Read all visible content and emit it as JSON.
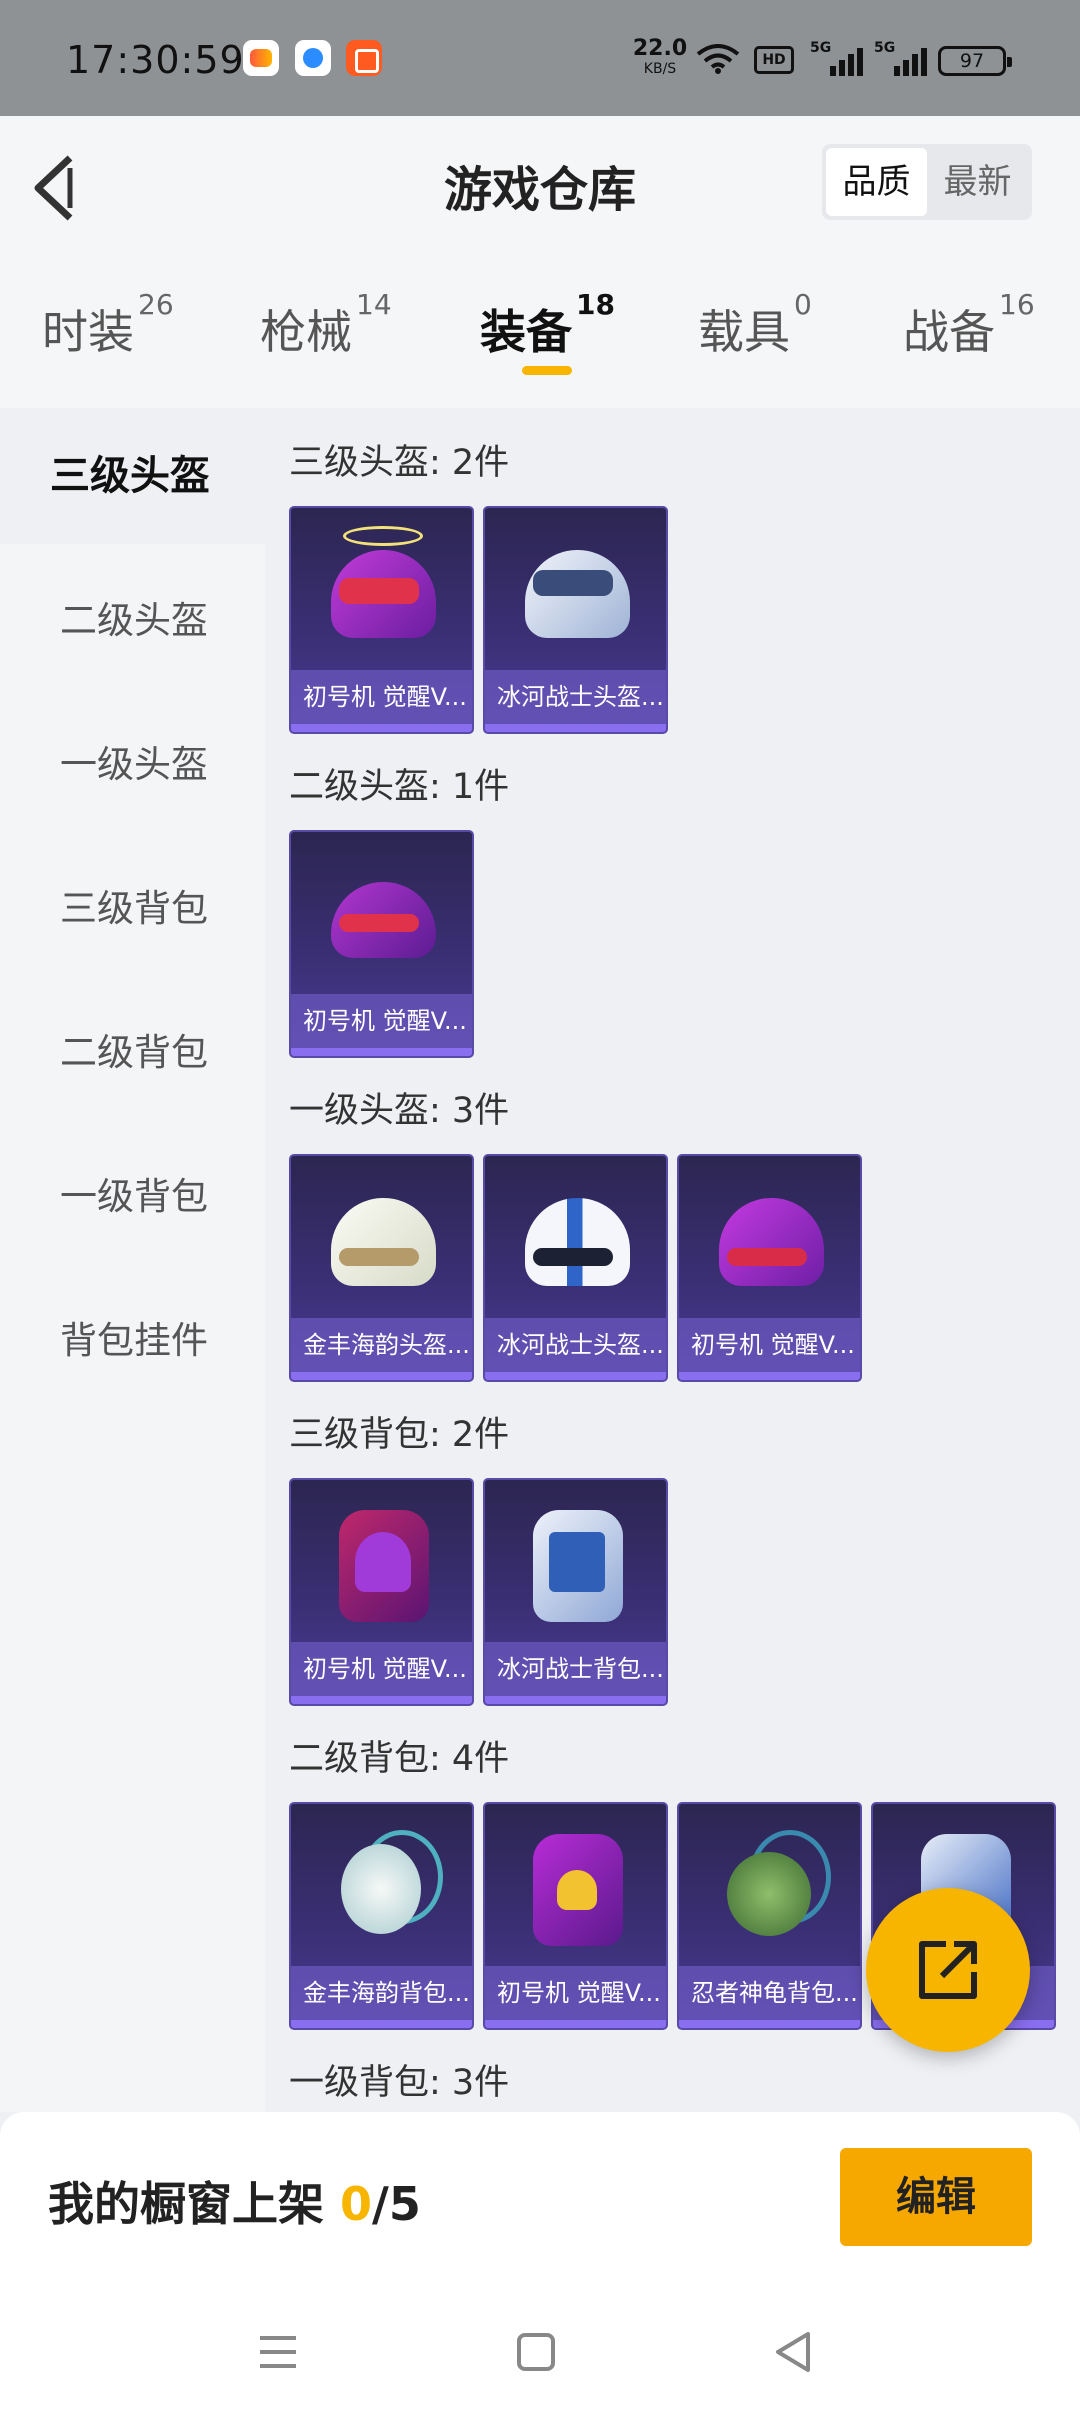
{
  "status_bar": {
    "time": "17:30:59",
    "net_speed": "22.0",
    "net_unit": "KB/S",
    "hd_badge": "HD",
    "signal_1": "5G",
    "signal_2": "5G",
    "battery": "97",
    "icons": [
      "game-app-icon",
      "search-app-icon",
      "camera-app-icon",
      "wifi-icon",
      "hd-icon",
      "signal-icon",
      "signal-icon",
      "battery-icon"
    ]
  },
  "header": {
    "title": "游戏仓库",
    "sort": {
      "quality": "品质",
      "latest": "最新",
      "active": "quality"
    }
  },
  "tabs": [
    {
      "name": "时装",
      "count": "26"
    },
    {
      "name": "枪械",
      "count": "14"
    },
    {
      "name": "装备",
      "count": "18",
      "active": true
    },
    {
      "name": "载具",
      "count": "0"
    },
    {
      "name": "战备",
      "count": "16"
    }
  ],
  "sidebar": {
    "items": [
      "三级头盔",
      "二级头盔",
      "一级头盔",
      "三级背包",
      "二级背包",
      "一级背包",
      "背包挂件"
    ],
    "active": 0
  },
  "sections": [
    {
      "title": "三级头盔: 2件",
      "items": [
        {
          "name": "初号机 觉醒V...",
          "icon": "purple-halo-helmet"
        },
        {
          "name": "冰河战士头盔...",
          "icon": "ice-warrior-helmet"
        }
      ]
    },
    {
      "title": "二级头盔: 1件",
      "items": [
        {
          "name": "初号机 觉醒V...",
          "icon": "purple-helmet"
        }
      ]
    },
    {
      "title": "一级头盔: 3件",
      "items": [
        {
          "name": "金丰海韵头盔...",
          "icon": "white-helmet"
        },
        {
          "name": "冰河战士头盔...",
          "icon": "blue-white-helmet"
        },
        {
          "name": "初号机 觉醒V...",
          "icon": "purple-helmet"
        }
      ]
    },
    {
      "title": "三级背包: 2件",
      "items": [
        {
          "name": "初号机 觉醒V...",
          "icon": "purple-backpack"
        },
        {
          "name": "冰河战士背包...",
          "icon": "ice-warrior-backpack"
        }
      ]
    },
    {
      "title": "二级背包: 4件",
      "items": [
        {
          "name": "金丰海韵背包...",
          "icon": "white-round-backpack"
        },
        {
          "name": "初号机 觉醒V...",
          "icon": "purple-backpack"
        },
        {
          "name": "忍者神龟背包...",
          "icon": "turtle-backpack"
        },
        {
          "name": "...",
          "icon": "blue-backpack"
        }
      ]
    },
    {
      "title": "一级背包: 3件",
      "items": []
    }
  ],
  "bottom": {
    "label": "我的橱窗上架 ",
    "current": "0",
    "total": "/5",
    "edit": "编辑"
  },
  "colors": {
    "accent": "#f7b500",
    "card_bg": "#3a2f74",
    "card_label": "#7864d2"
  }
}
